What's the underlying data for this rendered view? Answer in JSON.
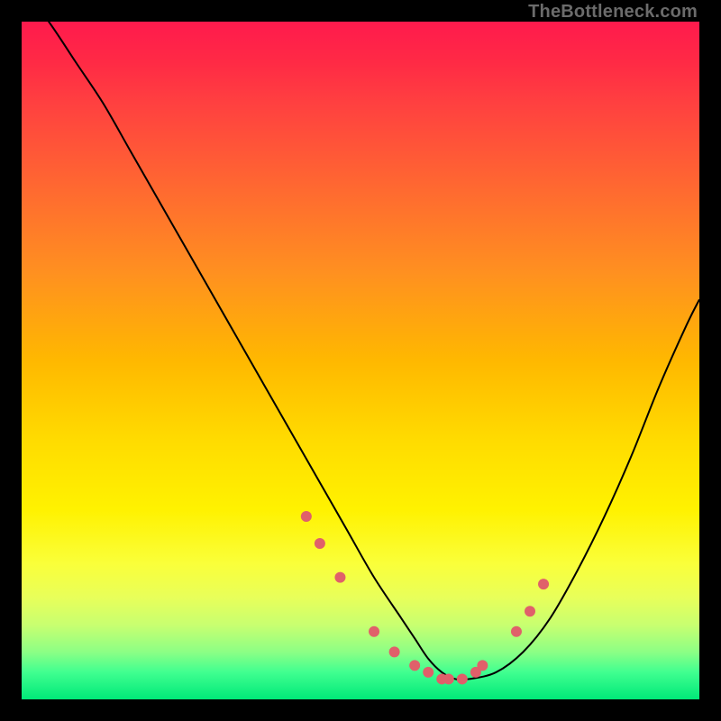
{
  "attribution": "TheBottleneck.com",
  "chart_data": {
    "type": "line",
    "title": "",
    "xlabel": "",
    "ylabel": "",
    "xlim": [
      0,
      100
    ],
    "ylim": [
      0,
      100
    ],
    "grid": false,
    "legend": false,
    "series": [
      {
        "name": "bottleneck-curve",
        "x": [
          0,
          4,
          8,
          12,
          16,
          20,
          24,
          28,
          32,
          36,
          40,
          44,
          48,
          52,
          56,
          58,
          60,
          62,
          64,
          66,
          70,
          74,
          78,
          82,
          86,
          90,
          94,
          98,
          100
        ],
        "y": [
          105,
          100,
          94,
          88,
          81,
          74,
          67,
          60,
          53,
          46,
          39,
          32,
          25,
          18,
          12,
          9,
          6,
          4,
          3,
          3,
          4,
          7,
          12,
          19,
          27,
          36,
          46,
          55,
          59
        ],
        "color": "#000000"
      }
    ],
    "markers": {
      "name": "highlight-points",
      "color": "#e0606a",
      "radius_px": 6,
      "x": [
        42,
        44,
        47,
        52,
        55,
        58,
        60,
        62,
        63,
        65,
        67,
        68,
        73,
        75,
        77
      ],
      "y": [
        27,
        23,
        18,
        10,
        7,
        5,
        4,
        3,
        3,
        3,
        4,
        5,
        10,
        13,
        17
      ]
    },
    "background_gradient": {
      "direction": "top-to-bottom",
      "stops": [
        {
          "pos": 0.0,
          "color": "#ff1a4d"
        },
        {
          "pos": 0.5,
          "color": "#ffb800"
        },
        {
          "pos": 0.8,
          "color": "#faff3a"
        },
        {
          "pos": 1.0,
          "color": "#00e878"
        }
      ]
    }
  }
}
